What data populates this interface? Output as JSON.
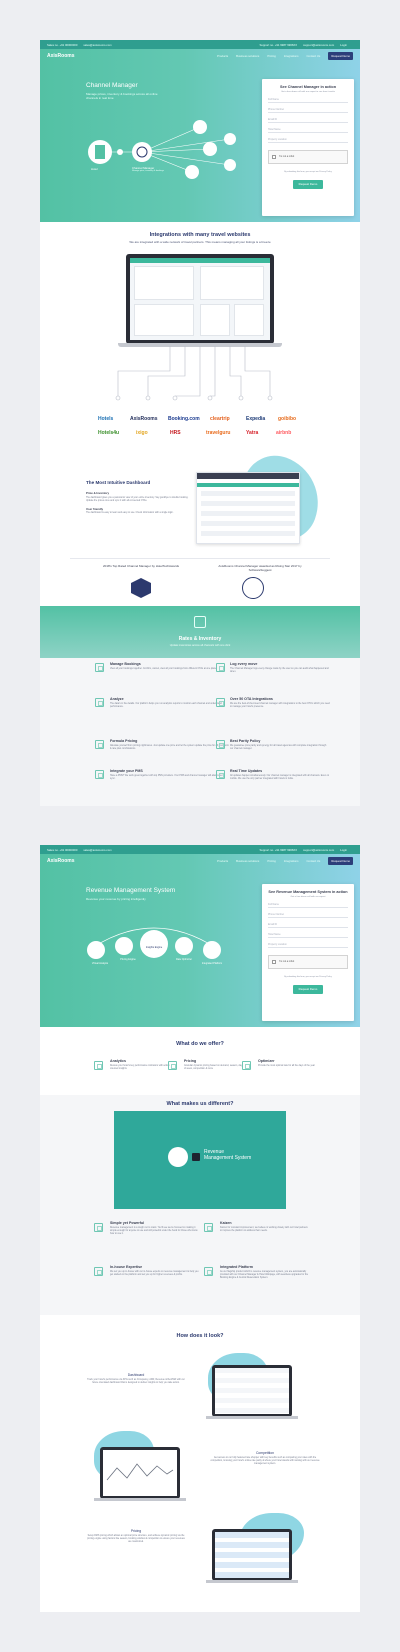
{
  "topbar": {
    "sales": "Sales no. +91 00000000",
    "email": "sales@axisrooms.com",
    "support": "Support no. +91 9987 9966XX",
    "support_email": "support@axisrooms.com",
    "login": "Login"
  },
  "nav": {
    "logo": "AxisRooms",
    "items": [
      "Products",
      "Business solutions",
      "Pricing",
      "Integrations",
      "Contact Us"
    ],
    "cta": "Request Demo"
  },
  "s1": {
    "title": "Channel Manager",
    "subtitle": "Manage prices, inventory & bookings across all online channels in real time",
    "diagram": {
      "hotel": "Hotel",
      "cm": "Channel Manager",
      "cm_sub": "Manage price, inventory & bookings"
    },
    "form": {
      "title": "See Channel Manager in action",
      "sub": "Get a free demo call with our expert to see how it works",
      "fields": [
        "Full Name",
        "Phone Number",
        "Email ID",
        "Hotel Name",
        "Property Location"
      ],
      "captcha": "I'm not a robot",
      "consent": "By submitting this form, you accept our Privacy Policy",
      "button": "Request Demo"
    },
    "integrations": {
      "title": "Integrations with many travel websites",
      "sub": "We are integrated with a wide network of travel partners. This means managing all your listings is a breeze",
      "brands_row1": [
        "Hotels",
        "AxisRooms",
        "Booking.com",
        "cleartrip",
        "Expedia",
        "goibibo"
      ],
      "brands_row2": [
        "Hotels4u",
        "ixigo",
        "HRS",
        "travelguru",
        "Yatra",
        "airbnb"
      ]
    },
    "dashboard": {
      "title": "The Most Intuitive Dashboard",
      "h1": "Price & Inventory",
      "t1": "The dashboard gives you a panoramic view of your entire inventory. Say goodbye to double booking. Update the prices once and sync it with all connected OTAs.",
      "h2": "User friendly",
      "t2": "The dashboard is easy to learn and easy to use. Check information with a single login."
    },
    "awards": {
      "left": "2018's Top Rated Channel Manager by HotelTechAwards",
      "right": "AxisRooms Channel Manager awarded as Rising Star 2017 by SoftwareSuggest"
    },
    "rates": {
      "title": "Rates & Inventory",
      "sub": "Update inventories across all channels with one click"
    },
    "features": [
      {
        "t": "Manage Bookings",
        "d": "View all your bookings together. Confirm, cancel, view all your bookings from different OTAs at one place."
      },
      {
        "t": "Log every move",
        "d": "The Channel Manager logs every change made by the user so you can audit what happened and when."
      },
      {
        "t": "Analyze",
        "d": "The data's in the details. Our platform helps you run analytics reports to monitor each channel and understand performance."
      },
      {
        "t": "Over 50 OTA Integrations",
        "d": "We are the best-of-the-breed channel manager with integrations to the best OTA's which you need to manage your hotel's presence."
      },
      {
        "t": "Formula Pricing",
        "d": "Alleviate yourself from pricing nightmares. Just update one price and let the system update the price for all your room & rate plan combinations."
      },
      {
        "t": "Best Parity Policy",
        "d": "We guarantee price parity and synergy for all travel agencies with complete integration through our channel manager."
      },
      {
        "t": "Integrate your PMS",
        "d": "Have a PMS? We work great together with top PMS providers. Your PMS and channel manager will always be in sync."
      },
      {
        "t": "Real Time Updates",
        "d": "All updates happen simultaneously. Our channel manager is integrated with all channels. Even on mobile. We use the only partner integrated with hotels in India."
      }
    ]
  },
  "s2": {
    "title": "Revenue Management System",
    "subtitle": "Revenue your revenue by pricing intelligently",
    "circles": [
      "Virtual Analysis",
      "Pricing Engine",
      "Insights Engine",
      "Rate Optimizer",
      "Integrated Platform"
    ],
    "form": {
      "title": "See Revenue Management System in action",
      "sub": "Get a free demo call with our expert",
      "fields": [
        "Full Name",
        "Phone Number",
        "Email ID",
        "Hotel Name",
        "Property Location"
      ],
      "captcha": "I'm not a robot",
      "consent": "By submitting this form, you accept our Privacy Policy",
      "button": "Request Demo"
    },
    "offer": {
      "title": "What do we offer?",
      "items": [
        {
          "t": "Analytics",
          "d": "Review your hotel's key performance indicators with action oriented insights"
        },
        {
          "t": "Pricing",
          "d": "Granular dynamic pricing based on demand, season, day of week, competition & more"
        },
        {
          "t": "Optimizer",
          "d": "Provide the most optimal rate for all the days of the year"
        }
      ]
    },
    "different": {
      "title": "What makes us different?",
      "video_title": "Revenue Management System",
      "items": [
        {
          "t": "Simple yet Powerful",
          "d": "Revenue management is a tough nut to crack. You'll see we've focused on making it simple enough for anyone to use and still powerful under the hood for those who know how to use it."
        },
        {
          "t": "Kaizen",
          "d": "Kaizen for constant improvement, we believe in working closely with our hotel partners to improve the platform to address their needs."
        },
        {
          "t": "In-house Expertise",
          "d": "We set you up in-house with our in-house experts on revenue management to help you get started on the platform and set you up for higher revenues & profits."
        },
        {
          "t": "Integrated Platform",
          "d": "As our flagship product which is revenue management system, you are automatically provided with our Channel Manager & Hotel Webpage, with seamless upgrades for the Booking Engine & Central Reservation System."
        }
      ]
    },
    "look": {
      "title": "How does it look?",
      "items": [
        {
          "t": "Dashboard",
          "d": "Track your hotel's performance via KPIs such as Occupancy, ADR, Revenue & RevPAR with our future orientated dashboard that is designed to deliver insights to help you take action."
        },
        {
          "t": "Competition",
          "d": "Get access to our fully featured rate shopper with key benefits such as comparing your rates with the competition, knowing your hotel's online rate parity & where your hotel stands with ranking with our revenue management system."
        },
        {
          "t": "Pricing",
          "d": "Setup RMS pricing which allows an optimal price structure, and achieve dynamic pricing via the pricing engine using factors like season, booking window & competition to ensure your revenues are maximized."
        }
      ]
    }
  },
  "colors": {
    "teal": "#53c1a4",
    "blue": "#8fd2e8",
    "navy": "#2c3a6e",
    "dark": "#2c3e7a"
  }
}
